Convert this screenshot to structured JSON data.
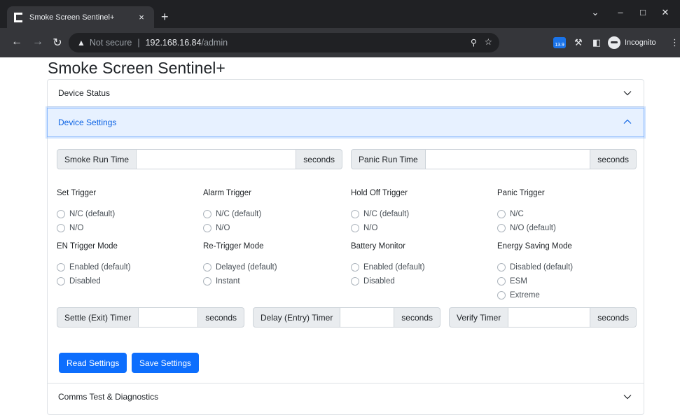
{
  "browser": {
    "tab_title": "Smoke Screen Sentinel+",
    "tab_close": "×",
    "new_tab": "+",
    "security_warning": "Not secure",
    "url_host": "192.168.16.84",
    "url_path": "/admin",
    "extension_badge": "13.9",
    "profile_label": "Incognito",
    "icons": [
      "back-arrow-icon",
      "forward-arrow-icon",
      "reload-icon",
      "warning-icon",
      "zoom-icon",
      "star-icon",
      "extension-icon",
      "puzzle-icon",
      "side-panel-icon",
      "incognito-icon",
      "menu-icon"
    ]
  },
  "page": {
    "title": "Smoke Screen Sentinel+"
  },
  "accordion": {
    "device_status": "Device Status",
    "device_settings": "Device Settings",
    "comms_test": "Comms Test & Diagnostics"
  },
  "run_times": {
    "smoke_label": "Smoke Run Time",
    "smoke_value": "",
    "smoke_unit": "seconds",
    "panic_label": "Panic Run Time",
    "panic_value": "",
    "panic_unit": "seconds"
  },
  "triggers": [
    {
      "title": "Set Trigger",
      "options": [
        "N/C (default)",
        "N/O"
      ]
    },
    {
      "title": "Alarm Trigger",
      "options": [
        "N/C (default)",
        "N/O"
      ]
    },
    {
      "title": "Hold Off Trigger",
      "options": [
        "N/C (default)",
        "N/O"
      ]
    },
    {
      "title": "Panic Trigger",
      "options": [
        "N/C",
        "N/O (default)"
      ]
    }
  ],
  "modes": [
    {
      "title": "EN Trigger Mode",
      "options": [
        "Enabled (default)",
        "Disabled"
      ]
    },
    {
      "title": "Re-Trigger Mode",
      "options": [
        "Delayed (default)",
        "Instant"
      ]
    },
    {
      "title": "Battery Monitor",
      "options": [
        "Enabled (default)",
        "Disabled"
      ]
    },
    {
      "title": "Energy Saving Mode",
      "options": [
        "Disabled (default)",
        "ESM",
        "Extreme"
      ]
    }
  ],
  "timers": {
    "settle_label": "Settle (Exit) Timer",
    "settle_unit": "seconds",
    "delay_label": "Delay (Entry) Timer",
    "delay_unit": "seconds",
    "verify_label": "Verify Timer",
    "verify_unit": "seconds"
  },
  "buttons": {
    "read": "Read Settings",
    "save": "Save Settings"
  },
  "colors": {
    "primary": "#0d6efd",
    "accordion_active_bg": "#e7f1ff",
    "accordion_active_text": "#0c63e4"
  }
}
